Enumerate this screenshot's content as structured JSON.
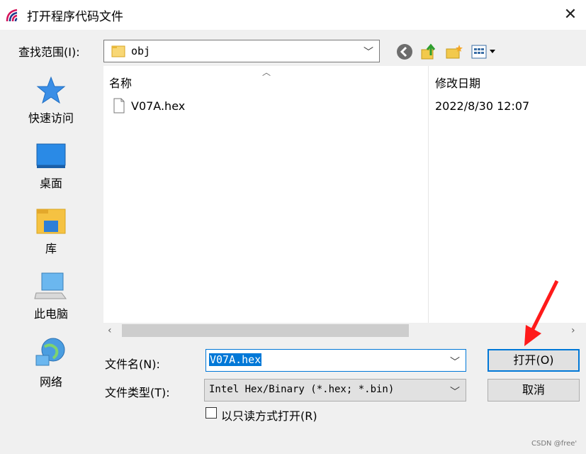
{
  "window": {
    "title": "打开程序代码文件",
    "close_glyph": "✕"
  },
  "lookin": {
    "label": "查找范围(I):",
    "value": "obj"
  },
  "places": [
    {
      "label": "快速访问",
      "icon": "star-icon"
    },
    {
      "label": "桌面",
      "icon": "desktop-icon"
    },
    {
      "label": "库",
      "icon": "library-icon"
    },
    {
      "label": "此电脑",
      "icon": "computer-icon"
    },
    {
      "label": "网络",
      "icon": "network-icon"
    }
  ],
  "columns": {
    "name": "名称",
    "date": "修改日期"
  },
  "files": [
    {
      "name": "V07A.hex",
      "date": "2022/8/30 12:07"
    }
  ],
  "filename": {
    "label": "文件名(N):",
    "value": "V07A.hex"
  },
  "filetype": {
    "label": "文件类型(T):",
    "value": "Intel Hex/Binary (*.hex; *.bin)"
  },
  "readonly": {
    "label": "以只读方式打开(R)"
  },
  "buttons": {
    "open": "打开(O)",
    "cancel": "取消"
  },
  "watermark": "CSDN @free'"
}
